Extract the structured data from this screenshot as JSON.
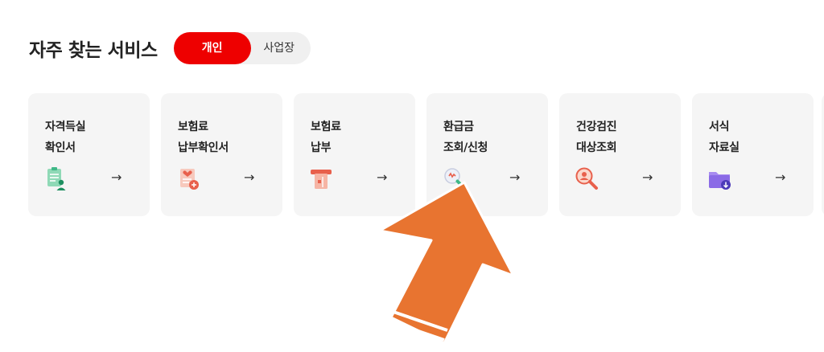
{
  "section": {
    "title": "자주 찾는 서비스"
  },
  "toggle": {
    "personal_label": "개인",
    "business_label": "사업장",
    "active": "personal",
    "active_color": "#ee0000"
  },
  "cards": [
    {
      "line1": "자격득실",
      "line2": "확인서",
      "icon": "certificate-icon",
      "arrow": "→"
    },
    {
      "line1": "보험료",
      "line2": "납부확인서",
      "icon": "payment-receipt-icon",
      "arrow": "→"
    },
    {
      "line1": "보험료",
      "line2": "납부",
      "icon": "card-payment-icon",
      "arrow": "→"
    },
    {
      "line1": "환급금",
      "line2": "조회/신청",
      "icon": "refund-search-icon",
      "arrow": "→"
    },
    {
      "line1": "건강검진",
      "line2": "대상조회",
      "icon": "checkup-search-icon",
      "arrow": "→"
    },
    {
      "line1": "서식",
      "line2": "자료실",
      "icon": "folder-download-icon",
      "arrow": "→"
    }
  ],
  "overlay": {
    "pointer_color": "#e87430"
  }
}
